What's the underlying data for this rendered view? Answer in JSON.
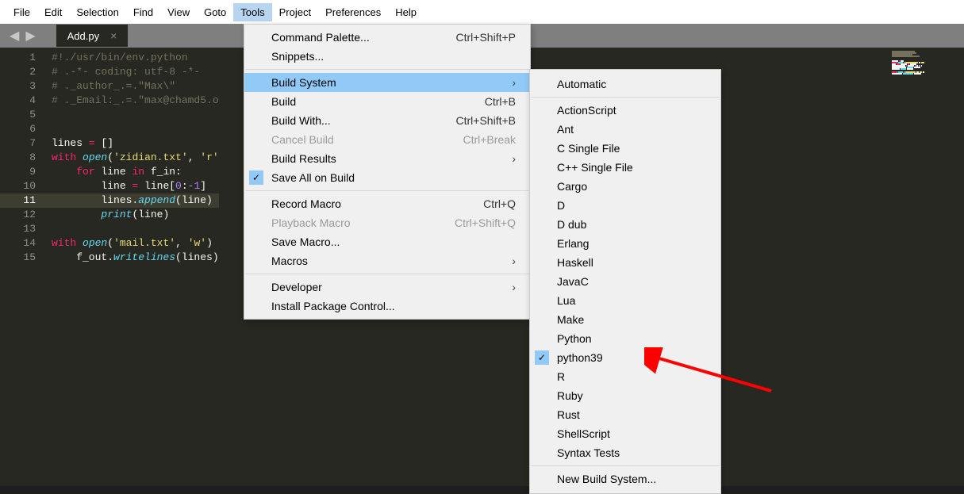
{
  "menubar": {
    "items": [
      "File",
      "Edit",
      "Selection",
      "Find",
      "View",
      "Goto",
      "Tools",
      "Project",
      "Preferences",
      "Help"
    ],
    "active_index": 6
  },
  "tab": {
    "title": "Add.py",
    "close_glyph": "×"
  },
  "nav": {
    "left": "◀",
    "right": "▶"
  },
  "gutter": {
    "lines": [
      "1",
      "2",
      "3",
      "4",
      "5",
      "6",
      "7",
      "8",
      "9",
      "10",
      "11",
      "12",
      "13",
      "14",
      "15"
    ],
    "highlight": 11
  },
  "code_lines": [
    {
      "segments": [
        {
          "cls": "c-comment",
          "t": "#!./usr/bin/env.python"
        }
      ]
    },
    {
      "segments": [
        {
          "cls": "c-comment",
          "t": "# .-*- coding: utf-8 -*-"
        }
      ]
    },
    {
      "segments": [
        {
          "cls": "c-comment",
          "t": "# ._author_.=.\"Max\\\""
        }
      ]
    },
    {
      "segments": [
        {
          "cls": "c-comment",
          "t": "# ._Email:_.=.\"max@chamd5.o"
        }
      ]
    },
    {
      "segments": [
        {
          "cls": "c-white",
          "t": ""
        }
      ]
    },
    {
      "segments": [
        {
          "cls": "c-white",
          "t": ""
        }
      ]
    },
    {
      "segments": [
        {
          "cls": "c-white",
          "t": "lines "
        },
        {
          "cls": "c-key",
          "t": "="
        },
        {
          "cls": "c-white",
          "t": " []"
        }
      ]
    },
    {
      "segments": [
        {
          "cls": "c-key",
          "t": "with"
        },
        {
          "cls": "c-white",
          "t": " "
        },
        {
          "cls": "c-func",
          "t": "open"
        },
        {
          "cls": "c-white",
          "t": "("
        },
        {
          "cls": "c-str",
          "t": "'zidian.txt'"
        },
        {
          "cls": "c-white",
          "t": ", "
        },
        {
          "cls": "c-str",
          "t": "'r'"
        }
      ]
    },
    {
      "segments": [
        {
          "cls": "c-white",
          "t": "    "
        },
        {
          "cls": "c-key",
          "t": "for"
        },
        {
          "cls": "c-white",
          "t": " line "
        },
        {
          "cls": "c-key",
          "t": "in"
        },
        {
          "cls": "c-white",
          "t": " f_in:"
        }
      ]
    },
    {
      "segments": [
        {
          "cls": "c-white",
          "t": "        line "
        },
        {
          "cls": "c-key",
          "t": "="
        },
        {
          "cls": "c-white",
          "t": " line["
        },
        {
          "cls": "c-num",
          "t": "0"
        },
        {
          "cls": "c-white",
          "t": ":"
        },
        {
          "cls": "c-num",
          "t": "-1"
        },
        {
          "cls": "c-white",
          "t": "]"
        }
      ]
    },
    {
      "segments": [
        {
          "cls": "c-white",
          "t": "        lines."
        },
        {
          "cls": "c-func",
          "t": "append"
        },
        {
          "cls": "c-white",
          "t": "(line)"
        }
      ],
      "hl": true
    },
    {
      "segments": [
        {
          "cls": "c-white",
          "t": "        "
        },
        {
          "cls": "c-func",
          "t": "print"
        },
        {
          "cls": "c-white",
          "t": "(line)"
        }
      ]
    },
    {
      "segments": [
        {
          "cls": "c-white",
          "t": ""
        }
      ]
    },
    {
      "segments": [
        {
          "cls": "c-key",
          "t": "with"
        },
        {
          "cls": "c-white",
          "t": " "
        },
        {
          "cls": "c-func",
          "t": "open"
        },
        {
          "cls": "c-white",
          "t": "("
        },
        {
          "cls": "c-str",
          "t": "'mail.txt'"
        },
        {
          "cls": "c-white",
          "t": ", "
        },
        {
          "cls": "c-str",
          "t": "'w'"
        },
        {
          "cls": "c-white",
          "t": ")"
        }
      ]
    },
    {
      "segments": [
        {
          "cls": "c-white",
          "t": "    f_out."
        },
        {
          "cls": "c-func",
          "t": "writelines"
        },
        {
          "cls": "c-white",
          "t": "(lines)"
        }
      ]
    }
  ],
  "tools_menu": [
    {
      "label": "Command Palette...",
      "shortcut": "Ctrl+Shift+P"
    },
    {
      "label": "Snippets..."
    },
    {
      "sep": true
    },
    {
      "label": "Build System",
      "submenu": true,
      "highlight": true
    },
    {
      "label": "Build",
      "shortcut": "Ctrl+B"
    },
    {
      "label": "Build With...",
      "shortcut": "Ctrl+Shift+B"
    },
    {
      "label": "Cancel Build",
      "shortcut": "Ctrl+Break",
      "disabled": true
    },
    {
      "label": "Build Results",
      "submenu": true
    },
    {
      "label": "Save All on Build",
      "check": true
    },
    {
      "sep": true
    },
    {
      "label": "Record Macro",
      "shortcut": "Ctrl+Q"
    },
    {
      "label": "Playback Macro",
      "shortcut": "Ctrl+Shift+Q",
      "disabled": true
    },
    {
      "label": "Save Macro..."
    },
    {
      "label": "Macros",
      "submenu": true
    },
    {
      "sep": true
    },
    {
      "label": "Developer",
      "submenu": true
    },
    {
      "label": "Install Package Control..."
    }
  ],
  "build_menu": [
    {
      "label": "Automatic"
    },
    {
      "sep": true
    },
    {
      "label": "ActionScript"
    },
    {
      "label": "Ant"
    },
    {
      "label": "C Single File"
    },
    {
      "label": "C++ Single File"
    },
    {
      "label": "Cargo"
    },
    {
      "label": "D"
    },
    {
      "label": "D dub"
    },
    {
      "label": "Erlang"
    },
    {
      "label": "Haskell"
    },
    {
      "label": "JavaC"
    },
    {
      "label": "Lua"
    },
    {
      "label": "Make"
    },
    {
      "label": "Python"
    },
    {
      "label": "python39",
      "check": true
    },
    {
      "label": "R"
    },
    {
      "label": "Ruby"
    },
    {
      "label": "Rust"
    },
    {
      "label": "ShellScript"
    },
    {
      "label": "Syntax Tests"
    },
    {
      "sep": true
    },
    {
      "label": "New Build System..."
    }
  ],
  "arrow_glyphs": {
    "sub": "›",
    "check": "✓"
  }
}
